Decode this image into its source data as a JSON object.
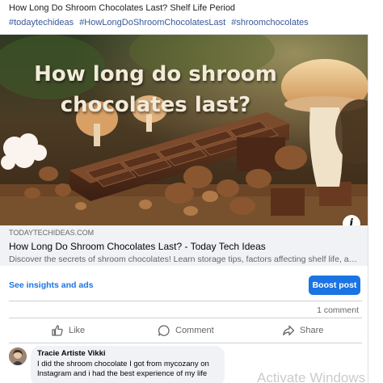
{
  "post": {
    "text": "How Long Do Shroom Chocolates Last? Shelf Life Period",
    "hashtags": [
      "#todaytechideas",
      "#HowLongDoShroomChocolatesLast",
      "#shroomchocolates"
    ]
  },
  "hero": {
    "title_line1": "How long do shroom",
    "title_line2": "chocolates last?",
    "info_label": "i"
  },
  "link_preview": {
    "domain": "TODAYTECHIDEAS.COM",
    "title": "How Long Do Shroom Chocolates Last? - Today Tech Ideas",
    "description": "Discover the secrets of shroom chocolates! Learn storage tips, factors affecting shelf life, and a..."
  },
  "insights": {
    "link_label": "See insights and ads",
    "boost_label": "Boost post"
  },
  "stats": {
    "comment_count": "1 comment"
  },
  "actions": {
    "like": "Like",
    "comment": "Comment",
    "share": "Share"
  },
  "comment": {
    "author": "Tracie Artiste Vikki",
    "text": "I did the shroom chocolate I got from mycozany on Instagram and i had the best experience of my life"
  },
  "watermark": "Activate Windows",
  "colors": {
    "accent": "#1b74e4",
    "hashtag": "#385898",
    "muted": "#65676b",
    "meta_bg": "#f0f2f5"
  }
}
